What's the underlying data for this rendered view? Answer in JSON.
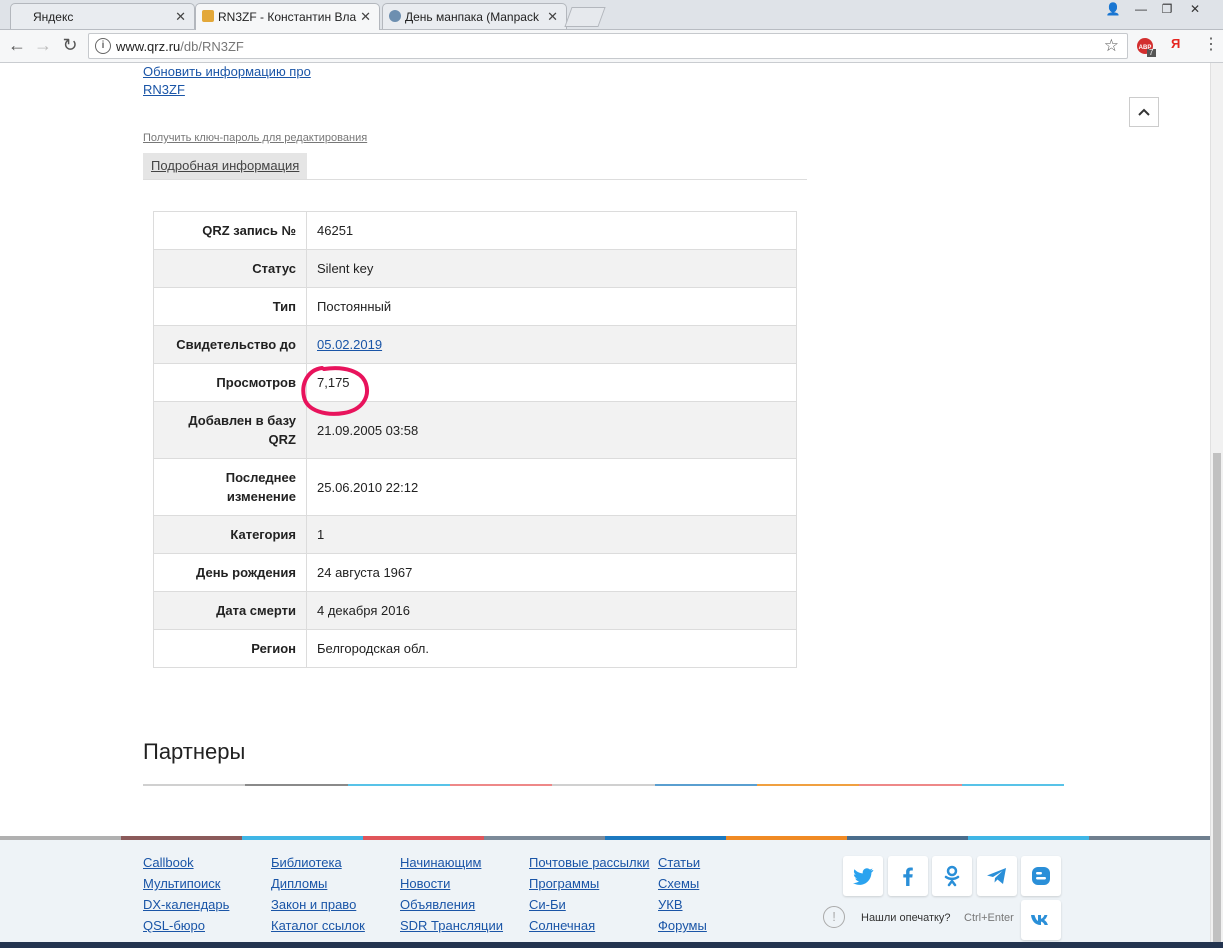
{
  "browser": {
    "tabs": [
      {
        "title": "Яндекс",
        "active": false
      },
      {
        "title": "RN3ZF - Константин Вла",
        "active": true
      },
      {
        "title": "День манпака (Manpack",
        "active": false
      }
    ],
    "url": {
      "host": "www.qrz.ru",
      "path": "/db/RN3ZF"
    },
    "extensions": {
      "adblock_count": "7",
      "yandex": "Я"
    }
  },
  "page": {
    "update_link": "Обновить информацию про RN3ZF",
    "key_link": "Получить ключ-пароль для редактирования",
    "details_tab": "Подробная информация",
    "rows": [
      {
        "label": "QRZ запись №",
        "value": "46251"
      },
      {
        "label": "Статус",
        "value": "Silent key"
      },
      {
        "label": "Тип",
        "value": "Постоянный"
      },
      {
        "label": "Свидетельство до",
        "value": "05.02.2019",
        "link": true
      },
      {
        "label": "Просмотров",
        "value": "7,175"
      },
      {
        "label": "Добавлен в базу QRZ",
        "value": "21.09.2005 03:58"
      },
      {
        "label": "Последнее изменение",
        "value": "25.06.2010 22:12"
      },
      {
        "label": "Категория",
        "value": "1"
      },
      {
        "label": "День рождения",
        "value": "24 августа 1967"
      },
      {
        "label": "Дата смерти",
        "value": "4 декабря 2016"
      },
      {
        "label": "Регион",
        "value": "Белгородская обл."
      }
    ],
    "partners_title": "Партнеры"
  },
  "footer": {
    "columns": [
      [
        "Callbook",
        "Мультипоиск",
        "DX-календарь",
        "QSL-бюро"
      ],
      [
        "Библиотека",
        "Дипломы",
        "Закон и право",
        "Каталог ссылок"
      ],
      [
        "Начинающим",
        "Новости",
        "Объявления",
        "SDR Трансляции"
      ],
      [
        "Почтовые рассылки",
        "Программы",
        "Си-Би",
        "Солнечная"
      ],
      [
        "Статьи",
        "Схемы",
        "УКВ",
        "Форумы"
      ]
    ],
    "typo_text": "Нашли опечатку?",
    "typo_shortcut": "Ctrl+Enter",
    "social": [
      "twitter-icon",
      "facebook-icon",
      "odnoklassniki-icon",
      "telegram-icon",
      "blogger-icon",
      "vk-icon"
    ]
  },
  "colors": {
    "link": "#1a55a7",
    "mark": "#e8135c",
    "footer_bg": "#eef3f7"
  }
}
